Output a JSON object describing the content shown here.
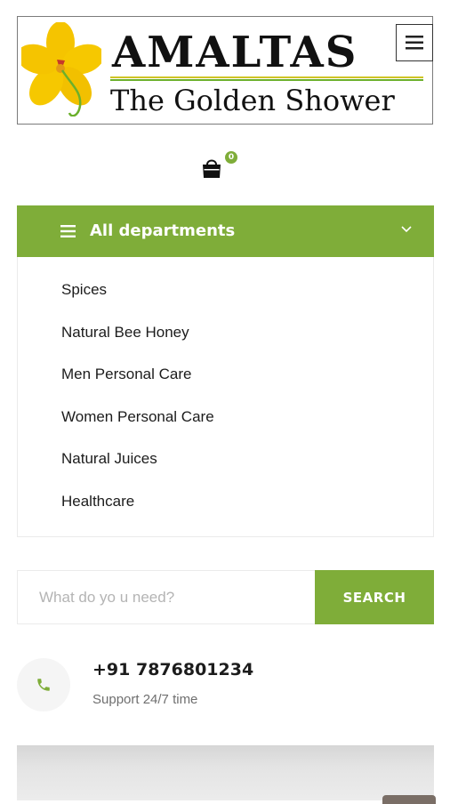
{
  "logo": {
    "title": "AMALTAS",
    "subtitle": "The Golden Shower"
  },
  "header": {
    "menu_icon": "hamburger-icon",
    "cart_icon": "shopping-bag-icon",
    "cart_count": "0"
  },
  "departments": {
    "title": "All departments",
    "items": [
      {
        "label": "Spices"
      },
      {
        "label": "Natural Bee Honey"
      },
      {
        "label": "Men Personal Care"
      },
      {
        "label": "Women Personal Care"
      },
      {
        "label": "Natural Juices"
      },
      {
        "label": "Healthcare"
      }
    ]
  },
  "search": {
    "placeholder": "What do yo u need?",
    "button_label": "SEARCH"
  },
  "contact": {
    "phone": "+91 7876801234",
    "support": "Support 24/7 time",
    "icon": "phone-icon"
  },
  "colors": {
    "accent": "#7fad39",
    "logo_yellow": "#f5c400"
  }
}
